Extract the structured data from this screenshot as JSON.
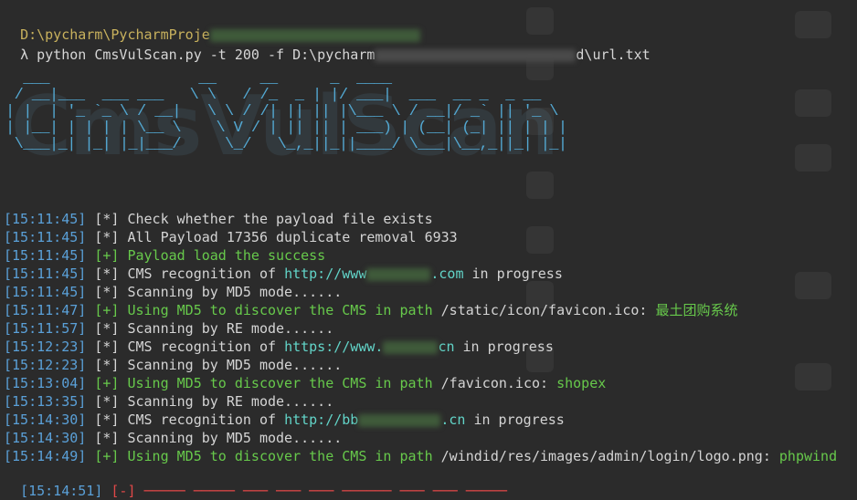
{
  "header": {
    "path_prefix": "D:\\pycharm\\PycharmProje",
    "prompt_symbol": "λ",
    "command_prefix": "python CmsVulScan.py -t 200 -f D:\\pycharm",
    "command_suffix": "d\\url.txt"
  },
  "banner": {
    "text": "CmsVulScan",
    "art": "  ___                 __     __      _  ____\n / __|___  ___ ___   \\ \\   / /_  _ | |/ ___|  ___  __ _  _ __\n| |  | '_ `_ \\ / __|   \\ \\ / /| || || |\\___ \\ / __|/ _` || '_ \\\n| |__| | | | | \\__ \\    \\ V / | || || | ___) | (__| (_| || | | |\n \\___|_| |_| |_|___/     \\_/   \\_,_||_||____/ \\___|\\__,_||_| |_|"
  },
  "log": [
    {
      "time": "[15:11:45]",
      "tag": "[*]",
      "type": "info",
      "msg": "Check whether the payload file exists"
    },
    {
      "time": "[15:11:45]",
      "tag": "[*]",
      "type": "info",
      "msg": "All Payload 17356 duplicate removal 6933"
    },
    {
      "time": "[15:11:45]",
      "tag": "[+]",
      "type": "success",
      "msg": "Payload load the success"
    },
    {
      "time": "[15:11:45]",
      "tag": "[*]",
      "type": "cms",
      "msg": "CMS recognition of",
      "url_start": "http://www",
      "url_end": ".com",
      "msg_end": "in progress"
    },
    {
      "time": "[15:11:45]",
      "tag": "[*]",
      "type": "info",
      "msg": "Scanning by MD5 mode......"
    },
    {
      "time": "[15:11:47]",
      "tag": "[+]",
      "type": "found",
      "msg": "Using MD5 to discover the CMS in path",
      "path": "/static/icon/favicon.ico:",
      "cms": "最土团购系统"
    },
    {
      "time": "[15:11:57]",
      "tag": "[*]",
      "type": "info",
      "msg": "Scanning by RE mode......"
    },
    {
      "time": "[15:12:23]",
      "tag": "[*]",
      "type": "cms",
      "msg": "CMS recognition of",
      "url_start": "https://www.",
      "url_end": "cn",
      "msg_end": "in progress"
    },
    {
      "time": "[15:12:23]",
      "tag": "[*]",
      "type": "info",
      "msg": "Scanning by MD5 mode......"
    },
    {
      "time": "[15:13:04]",
      "tag": "[+]",
      "type": "found",
      "msg": "Using MD5 to discover the CMS in path",
      "path": "/favicon.ico:",
      "cms": "shopex"
    },
    {
      "time": "[15:13:35]",
      "tag": "[*]",
      "type": "info",
      "msg": "Scanning by RE mode......"
    },
    {
      "time": "[15:14:30]",
      "tag": "[*]",
      "type": "cms",
      "msg": "CMS recognition of",
      "url_start": "http://bb",
      "url_end": ".cn",
      "msg_end": "in progress"
    },
    {
      "time": "[15:14:30]",
      "tag": "[*]",
      "type": "info",
      "msg": "Scanning by MD5 mode......"
    },
    {
      "time": "[15:14:49]",
      "tag": "[+]",
      "type": "found",
      "msg": "Using MD5 to discover the CMS in path",
      "path": "/windid/res/images/admin/login/logo.png:",
      "cms": "phpwind"
    }
  ],
  "cutoff_time": "[15:14:51]",
  "colors": {
    "timestamp": "#5aa0d8",
    "success": "#67c94b",
    "url": "#62d4c8",
    "banner": "#53a8d2",
    "error": "#e04848"
  }
}
